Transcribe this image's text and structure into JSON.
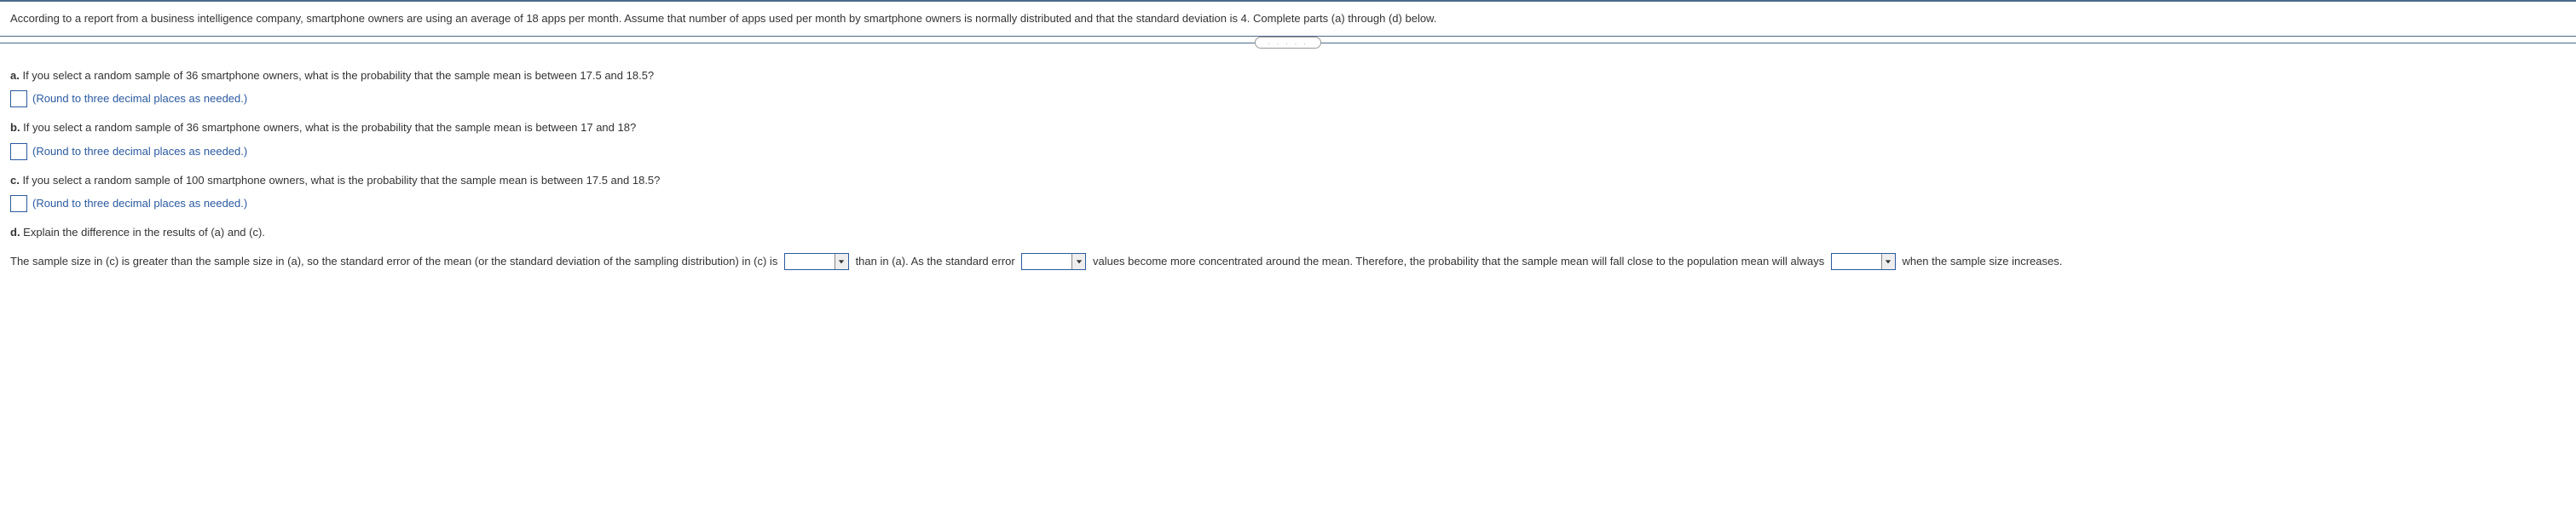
{
  "problem_statement": "According to a report from a business intelligence company, smartphone owners are using an average of 18 apps per month. Assume that number of apps used per month by smartphone owners is normally distributed and that the standard deviation is 4. Complete parts (a) through (d) below.",
  "divider_dots": ". . . . .",
  "parts": {
    "a": {
      "label": "a.",
      "text": " If you select a random sample of 36 smartphone owners, what is the probability that the sample mean is between 17.5 and 18.5?",
      "hint": "(Round to three decimal places as needed.)"
    },
    "b": {
      "label": "b.",
      "text": " If you select a random sample of 36 smartphone owners, what is the probability that the sample mean is between 17 and 18?",
      "hint": "(Round to three decimal places as needed.)"
    },
    "c": {
      "label": "c.",
      "text": " If you select a random sample of 100 smartphone owners, what is the probability that the sample mean is between 17.5 and 18.5?",
      "hint": "(Round to three decimal places as needed.)"
    },
    "d": {
      "label": "d.",
      "text": " Explain the difference in the results of (a) and (c).",
      "seg1": "The sample size in (c) is greater than the sample size in (a), so the standard error of the mean (or the standard deviation of the sampling distribution) in (c) is ",
      "seg2": " than in (a). As the standard error ",
      "seg3": " values become more concentrated around the mean. Therefore, the probability that the sample mean will fall close to the population mean will always ",
      "seg4": " when the sample size increases."
    }
  }
}
